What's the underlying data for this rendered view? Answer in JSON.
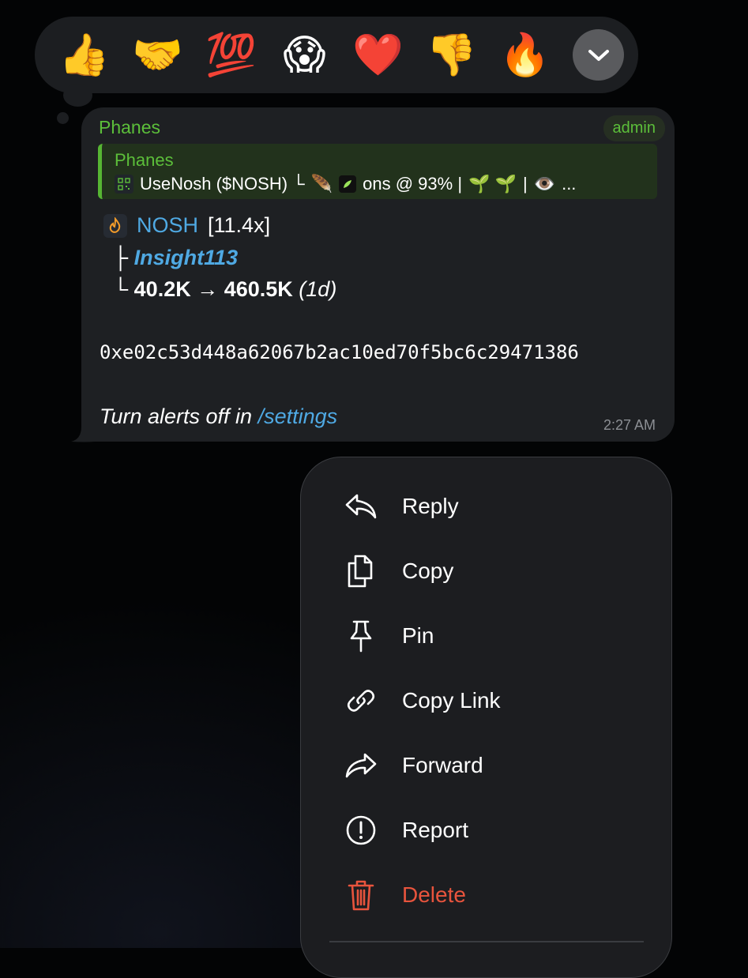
{
  "reactions": {
    "items": [
      {
        "name": "thumbs-up",
        "glyph": "👍"
      },
      {
        "name": "handshake",
        "glyph": "🤝"
      },
      {
        "name": "hundred",
        "glyph": "💯"
      },
      {
        "name": "screaming-face",
        "glyph": "😱"
      },
      {
        "name": "red-heart",
        "glyph": "❤️"
      },
      {
        "name": "thumbs-down",
        "glyph": "👎"
      },
      {
        "name": "fire",
        "glyph": "🔥"
      }
    ],
    "expand_icon": "chevron-down-icon"
  },
  "message": {
    "sender": "Phanes",
    "badge": "admin",
    "reply": {
      "sender": "Phanes",
      "text_pre": "UseNosh ($NOSH) └",
      "feather": "🪶",
      "text_mid": "ons @ 93% |",
      "seedlings": "🌱 🌱",
      "sep": "|",
      "eye": "👁️",
      "ellipsis": "..."
    },
    "token_name": "NOSH",
    "multiplier": "[11.4x]",
    "branch1": "├",
    "caller": "Insight113",
    "branch2": "└",
    "mcap_change": "40.2K → 460.5K",
    "duration": "(1d)",
    "address": "0xe02c53d448a62067b2ac10ed70f5bc6c29471386",
    "footer_text": "Turn alerts off in",
    "footer_link": "/settings",
    "time": "2:27 AM"
  },
  "menu": {
    "items": [
      {
        "label": "Reply",
        "icon": "reply-icon"
      },
      {
        "label": "Copy",
        "icon": "copy-icon"
      },
      {
        "label": "Pin",
        "icon": "pin-icon"
      },
      {
        "label": "Copy Link",
        "icon": "link-icon"
      },
      {
        "label": "Forward",
        "icon": "forward-icon"
      },
      {
        "label": "Report",
        "icon": "report-icon"
      },
      {
        "label": "Delete",
        "icon": "trash-icon"
      }
    ]
  },
  "colors": {
    "accent_blue": "#4fa9e3",
    "sender_green": "#5cbf3a",
    "danger_red": "#e8543d",
    "bubble_bg": "#1e2023",
    "menu_bg": "#1c1d20"
  }
}
